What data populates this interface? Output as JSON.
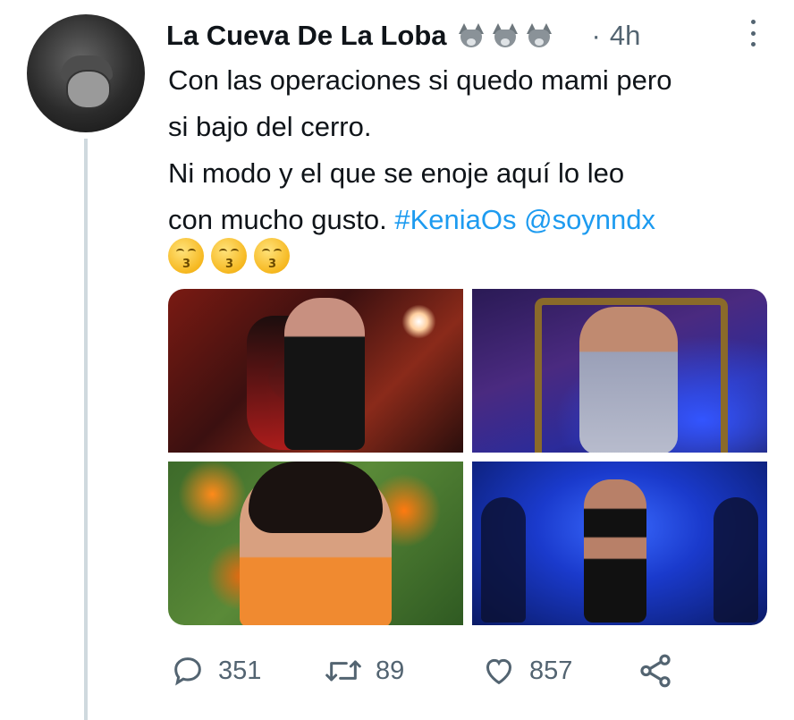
{
  "author": {
    "display_name": "La Cueva De La Loba",
    "badge_icons": [
      "wolf-face-icon",
      "wolf-face-icon",
      "wolf-face-icon"
    ],
    "separator": "·",
    "time": "4h"
  },
  "tweet": {
    "lines": [
      "Con las operaciones si quedo mami pero",
      "si bajo del cerro.",
      "Ni modo y el que se enoje aquí  lo leo",
      "con mucho gusto. "
    ],
    "hashtag": "#KeniaOs",
    "mention": "@soynndx",
    "emoji_icons": [
      "kissing-smiling-eyes-icon",
      "kissing-smiling-eyes-icon",
      "kissing-smiling-eyes-icon"
    ],
    "emoji_mouth": "3"
  },
  "media": {
    "count": 4,
    "photos": [
      "concert-photo",
      "throne-photo",
      "flowers-photo",
      "stage-photo"
    ]
  },
  "actions": {
    "reply_count": "351",
    "retweet_count": "89",
    "like_count": "857"
  },
  "colors": {
    "text": "#0f1419",
    "secondary": "#536471",
    "link": "#1d9bf0",
    "thread_line": "#cfd9de"
  }
}
